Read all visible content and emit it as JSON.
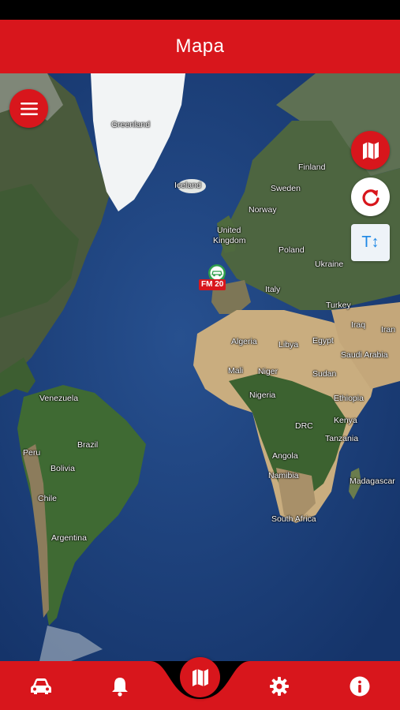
{
  "header": {
    "title": "Mapa"
  },
  "colors": {
    "brand": "#d8161c",
    "accent_blue": "#1e88e5"
  },
  "map": {
    "labels": {
      "greenland": "Greenland",
      "iceland": "Iceland",
      "finland": "Finland",
      "sweden": "Sweden",
      "norway": "Norway",
      "united": "United",
      "kingdom": "Kingdom",
      "poland": "Poland",
      "ukraine": "Ukraine",
      "italy": "Italy",
      "turkey": "Turkey",
      "iraq": "Iraq",
      "iran": "Iran",
      "algeria": "Algeria",
      "libya": "Libya",
      "egypt": "Egypt",
      "saudi_arabia": "Saudi Arabia",
      "mali": "Mali",
      "niger": "Niger",
      "sudan": "Sudan",
      "nigeria": "Nigeria",
      "ethiopia": "Ethiopia",
      "venezuela": "Venezuela",
      "drc": "DRC",
      "kenya": "Kenya",
      "tanzania": "Tanzania",
      "brazil": "Brazil",
      "peru": "Peru",
      "bolivia": "Bolivia",
      "angola": "Angola",
      "chile": "Chile",
      "namibia": "Namibia",
      "madagascar": "Madagascar",
      "south_africa": "South Africa",
      "argentina": "Argentina"
    },
    "vehicle_label": "FM   20"
  },
  "controls": {
    "menu_icon": "hamburger-icon",
    "map_type_icon": "map-icon",
    "refresh_icon": "refresh-icon",
    "text_size_label": "T↕"
  },
  "bottom_nav": {
    "items": [
      {
        "icon": "car-icon"
      },
      {
        "icon": "bell-icon"
      },
      {
        "icon": "map-icon"
      },
      {
        "icon": "gear-icon"
      },
      {
        "icon": "info-icon"
      }
    ]
  }
}
